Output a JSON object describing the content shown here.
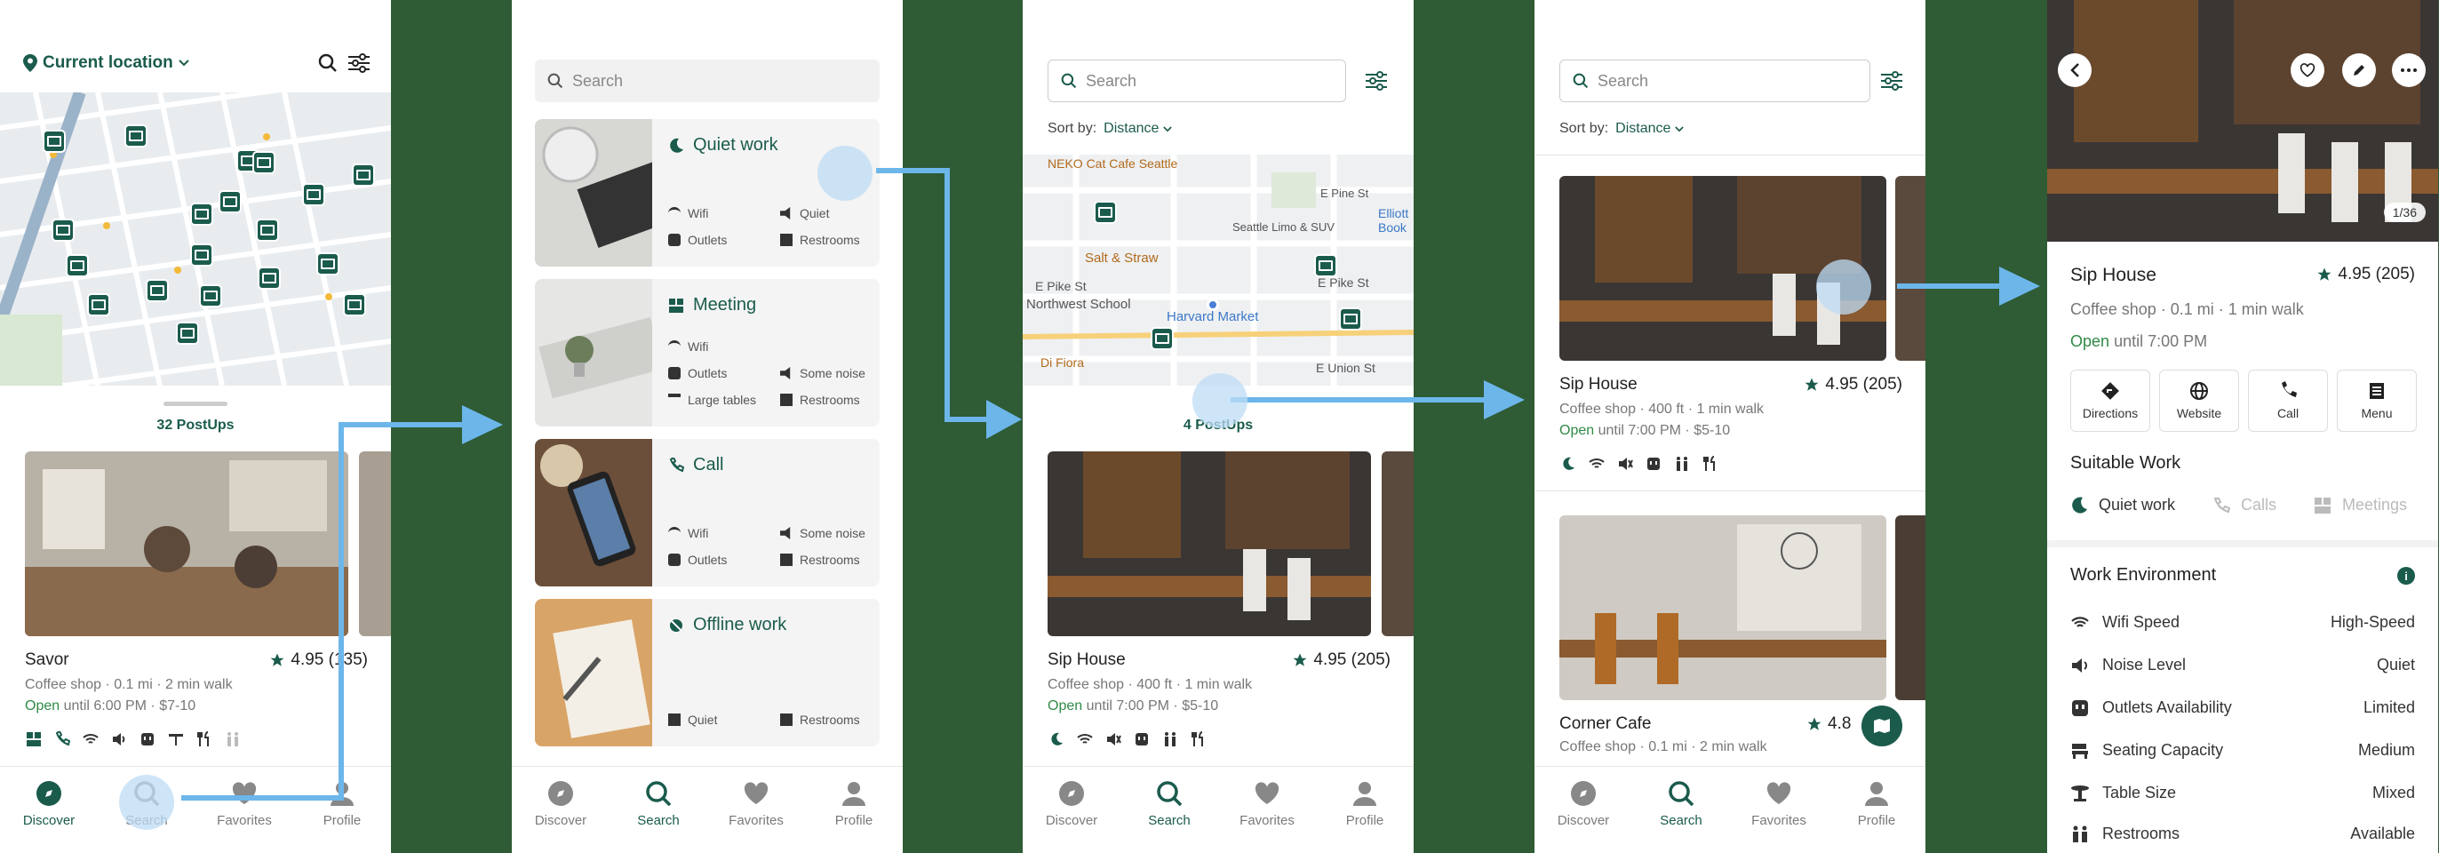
{
  "discover": {
    "location_label": "Current location",
    "postups_count": "32 PostUps",
    "cafe": {
      "name": "Savor",
      "rating": "4.95 (135)",
      "subtitle": "Coffee shop · 0.1 mi · 2 min walk",
      "open": "Open",
      "hours": "until 6:00 PM · $7-10"
    }
  },
  "search_screen": {
    "placeholder": "Search",
    "categories": [
      {
        "title": "Quiet work",
        "features": [
          "Wifi",
          "Outlets",
          "Quiet",
          "Restrooms"
        ]
      },
      {
        "title": "Meeting",
        "features": [
          "Wifi",
          "Outlets",
          "Large tables",
          "Some noise",
          "Restrooms"
        ]
      },
      {
        "title": "Call",
        "features": [
          "Wifi",
          "Outlets",
          "Some noise",
          "Restrooms"
        ]
      },
      {
        "title": "Offline work",
        "features": [
          "Quiet",
          "Restrooms"
        ]
      }
    ]
  },
  "results_map": {
    "placeholder": "Search",
    "sort_label": "Sort by:",
    "sort_value": "Distance",
    "map_labels": [
      "NEKO Cat Cafe Seattle",
      "E Pine St",
      "Seattle Limo & SUV",
      "Elliott Book",
      "Salt & Straw",
      "E Pike St",
      "E Pike St",
      "Northwest School",
      "Harvard Market",
      "Di Fiora",
      "E Union St"
    ],
    "postups_count": "4 PostUps",
    "cafe": {
      "name": "Sip House",
      "rating": "4.95 (205)",
      "subtitle": "Coffee shop · 400 ft · 1 min walk",
      "open": "Open",
      "hours": "until 7:00 PM · $5-10"
    }
  },
  "results_list": {
    "placeholder": "Search",
    "sort_label": "Sort by:",
    "sort_value": "Distance",
    "cafes": [
      {
        "name": "Sip House",
        "rating": "4.95 (205)",
        "subtitle": "Coffee shop · 400 ft · 1 min walk",
        "open": "Open",
        "hours": "until 7:00 PM · $5-10"
      },
      {
        "name": "Corner Cafe",
        "rating": "4.8",
        "subtitle": "Coffee shop · 0.1 mi · 2 min walk"
      }
    ]
  },
  "detail": {
    "pager": "1/36",
    "name": "Sip House",
    "rating": "4.95 (205)",
    "subtitle": "Coffee shop · 0.1 mi · 1 min walk",
    "open": "Open",
    "hours": "until 7:00 PM",
    "actions": [
      "Directions",
      "Website",
      "Call",
      "Menu"
    ],
    "suitable_title": "Suitable Work",
    "suitable": [
      "Quiet work",
      "Calls",
      "Meetings"
    ],
    "env_title": "Work Environment",
    "env": [
      {
        "label": "Wifi Speed",
        "value": "High-Speed"
      },
      {
        "label": "Noise Level",
        "value": "Quiet"
      },
      {
        "label": "Outlets Availability",
        "value": "Limited"
      },
      {
        "label": "Seating Capacity",
        "value": "Medium"
      },
      {
        "label": "Table Size",
        "value": "Mixed"
      },
      {
        "label": "Restrooms",
        "value": "Available"
      }
    ]
  },
  "nav": [
    "Discover",
    "Search",
    "Favorites",
    "Profile"
  ],
  "colors": {
    "accent": "#1a5b4c",
    "open": "#2f8a46",
    "star": "#1a5b4c",
    "backdrop": "#2f5b35",
    "arrow": "#6cb6ea"
  }
}
